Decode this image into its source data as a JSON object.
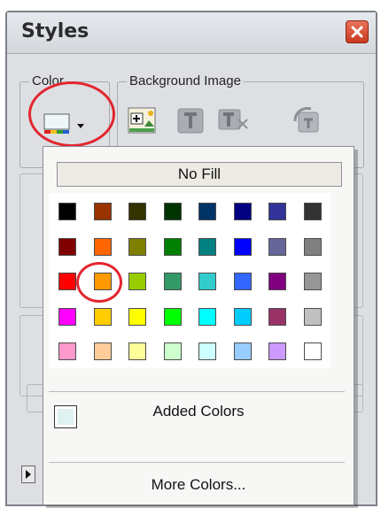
{
  "window": {
    "title": "Styles"
  },
  "color_group": {
    "label": "Color"
  },
  "background_group": {
    "label": "Background Image"
  },
  "dropdown": {
    "no_fill_label": "No Fill",
    "added_colors_label": "Added Colors",
    "more_colors_label": "More Colors...",
    "selected_color": "#ff8c00",
    "added_colors": [
      "#dff1f0"
    ],
    "palette": [
      [
        "#000000",
        "#993300",
        "#333300",
        "#003300",
        "#003366",
        "#000080",
        "#333399",
        "#333333"
      ],
      [
        "#800000",
        "#ff6600",
        "#808000",
        "#008000",
        "#008080",
        "#0000ff",
        "#666699",
        "#808080"
      ],
      [
        "#ff0000",
        "#ff9900",
        "#99cc00",
        "#339966",
        "#33cccc",
        "#3366ff",
        "#800080",
        "#969696"
      ],
      [
        "#ff00ff",
        "#ffcc00",
        "#ffff00",
        "#00ff00",
        "#00ffff",
        "#00ccff",
        "#993366",
        "#c0c0c0"
      ],
      [
        "#ff99cc",
        "#ffcc99",
        "#ffff99",
        "#ccffcc",
        "#ccffff",
        "#99ccff",
        "#cc99ff",
        "#ffffff"
      ]
    ]
  },
  "highlight_color": "#e3262f"
}
